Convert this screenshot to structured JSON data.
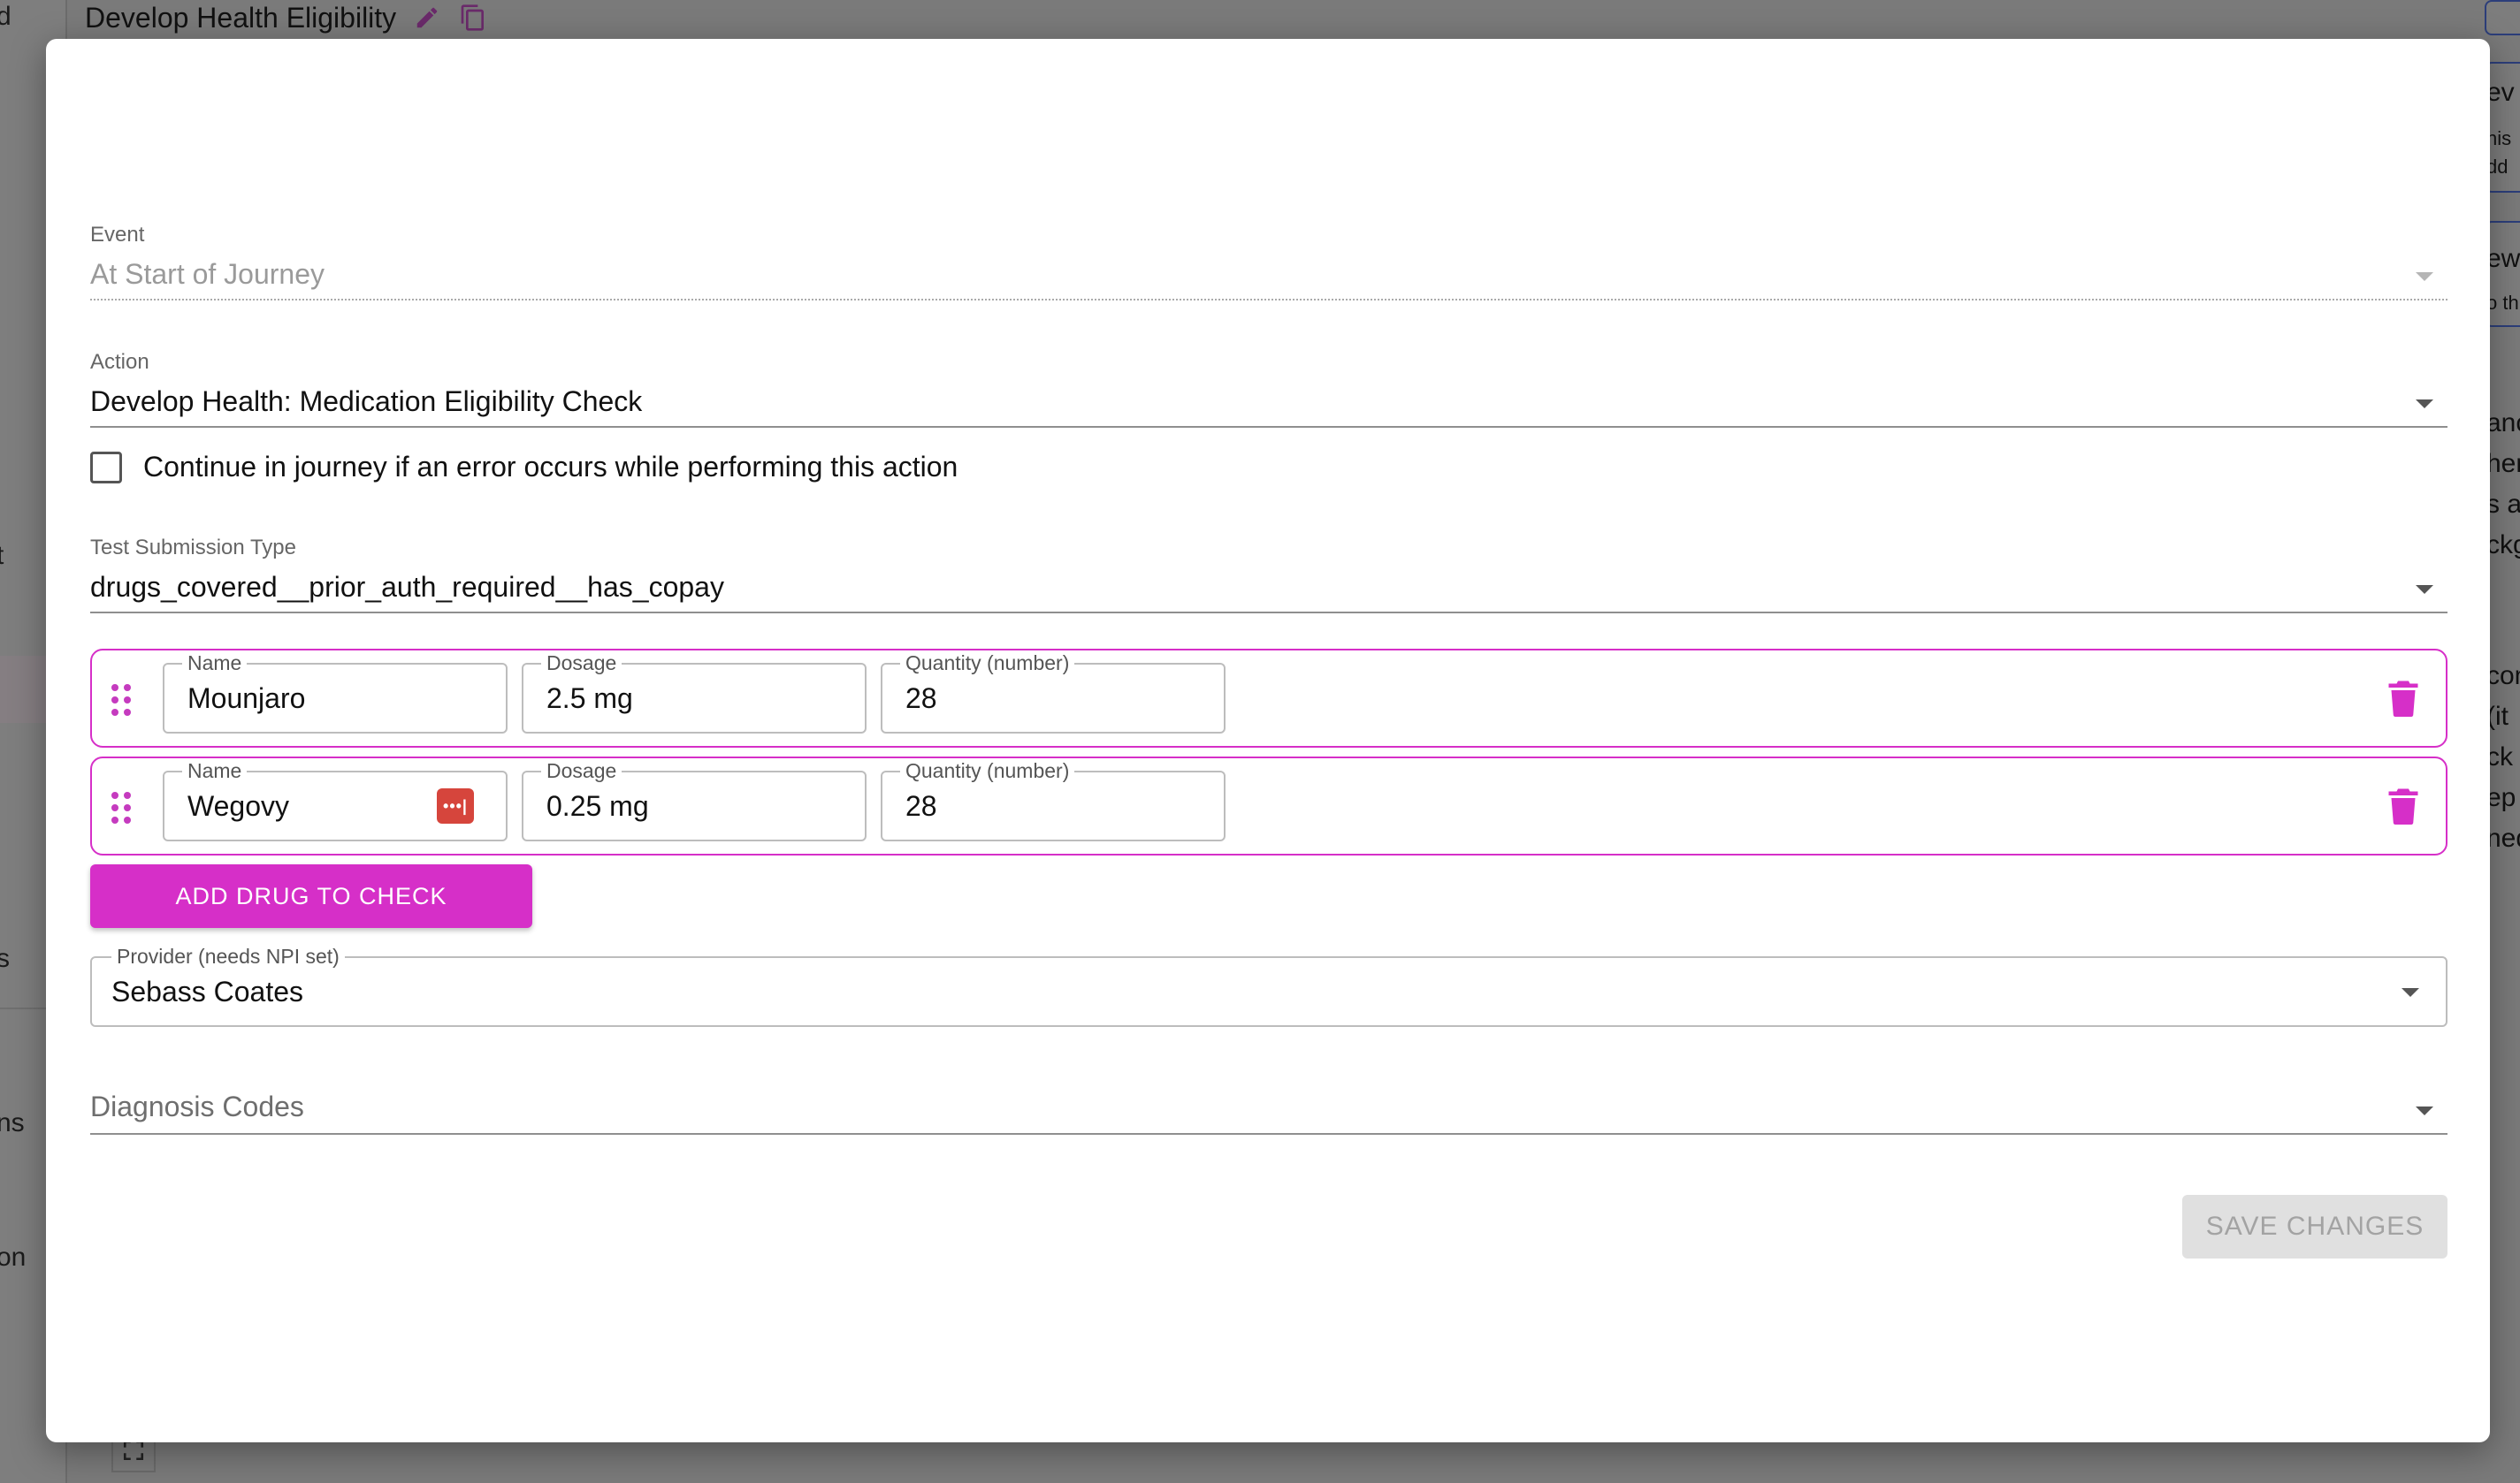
{
  "background": {
    "page_title": "Develop Health Eligibility",
    "left_fragments": [
      "d",
      "t",
      "s",
      "ns",
      "on"
    ],
    "right_fragments": [
      "ev",
      "his",
      "dd",
      "ew",
      "o th",
      "anc",
      "her",
      "s a",
      "ckg",
      "con",
      "(it",
      "ck",
      "ep",
      "ned"
    ]
  },
  "modal": {
    "event": {
      "label": "Event",
      "value": "At Start of Journey"
    },
    "action": {
      "label": "Action",
      "value": "Develop Health: Medication Eligibility Check"
    },
    "continue_on_error": {
      "label": "Continue in journey if an error occurs while performing this action",
      "checked": false
    },
    "test_submission_type": {
      "label": "Test Submission Type",
      "value": "drugs_covered__prior_auth_required__has_copay"
    },
    "drugs": [
      {
        "name_label": "Name",
        "name": "Mounjaro",
        "dosage_label": "Dosage",
        "dosage": "2.5 mg",
        "quantity_label": "Quantity (number)",
        "quantity": "28"
      },
      {
        "name_label": "Name",
        "name": "Wegovy",
        "dosage_label": "Dosage",
        "dosage": "0.25 mg",
        "quantity_label": "Quantity (number)",
        "quantity": "28"
      }
    ],
    "add_drug_label": "ADD DRUG TO CHECK",
    "provider": {
      "label": "Provider (needs NPI set)",
      "value": "Sebass Coates"
    },
    "diagnosis_codes": {
      "placeholder": "Diagnosis Codes"
    },
    "save_label": "SAVE CHANGES",
    "accent_color": "#d62fc8",
    "icons": [
      "pencil-icon",
      "copy-icon",
      "drag-handle-icon",
      "trash-icon",
      "password-manager-icon",
      "chevron-down-icon",
      "fullscreen-icon"
    ]
  }
}
